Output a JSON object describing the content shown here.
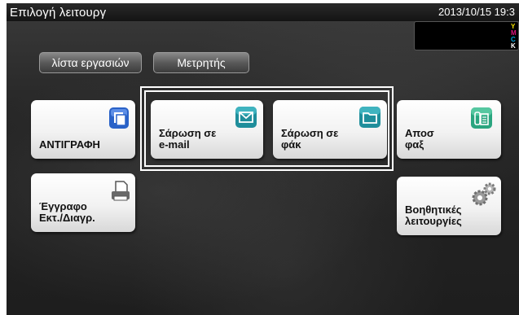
{
  "window": {
    "title": "Επιλογή λειτουργ",
    "datetime": "2013/10/15 19:3"
  },
  "toner": [
    "Y",
    "M",
    "C",
    "K"
  ],
  "tabs": {
    "job_list": "λίστα εργασιών",
    "counter": "Μετρητής"
  },
  "tiles": {
    "copy": "ΑΝΤΙΓΡΑΦΗ",
    "scan_email": "Σάρωση σε\ne-mail",
    "scan_folder": "Σάρωση σε\nφάκ",
    "fax": "Αποσ\nφαξ",
    "document": "Έγγραφο\nΕκτ./Διαγρ.",
    "utility": "Βοηθητικές\nλειτουργίες"
  },
  "icons": {
    "copy": "copy-icon",
    "scan_email": "envelope-icon",
    "scan_folder": "folder-icon",
    "fax": "fax-icon",
    "document": "printer-icon",
    "utility": "gears-icon"
  },
  "colors": {
    "toner_y": "#f5e400",
    "toner_m": "#e0157d",
    "toner_c": "#00a7e0",
    "toner_k": "#ffffff",
    "copy_icon": "#2a62c8",
    "scan_icon": "#1f8e9b",
    "fax_icon": "#2aa57f"
  }
}
